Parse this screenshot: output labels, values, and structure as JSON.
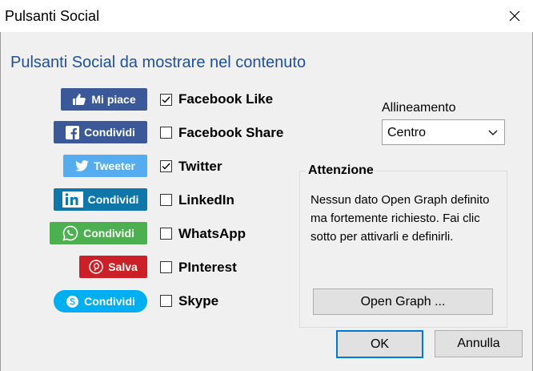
{
  "window": {
    "title": "Pulsanti Social"
  },
  "heading": "Pulsanti Social da mostrare nel contenuto",
  "social": [
    {
      "button_label": "Mi piace",
      "icon": "thumbs-up-icon",
      "color": "#3b5998",
      "checkbox_label": "Facebook Like",
      "checked": true
    },
    {
      "button_label": "Condividi",
      "icon": "facebook-icon",
      "color": "#3b5998",
      "checkbox_label": "Facebook Share",
      "checked": false
    },
    {
      "button_label": "Tweeter",
      "icon": "twitter-bird-icon",
      "color": "#55acee",
      "checkbox_label": "Twitter",
      "checked": true
    },
    {
      "button_label": "Condividi",
      "icon": "linkedin-icon",
      "color": "#0e76a8",
      "checkbox_label": "LinkedIn",
      "checked": false
    },
    {
      "button_label": "Condividi",
      "icon": "whatsapp-icon",
      "color": "#4caf50",
      "checkbox_label": "WhatsApp",
      "checked": false
    },
    {
      "button_label": "Salva",
      "icon": "pinterest-icon",
      "color": "#cb2027",
      "checkbox_label": "PInterest",
      "checked": false
    },
    {
      "button_label": "Condividi",
      "icon": "skype-icon",
      "color": "#00aff0",
      "checkbox_label": "Skype",
      "checked": false
    }
  ],
  "alignment": {
    "label": "Allineamento",
    "value": "Centro"
  },
  "warning": {
    "title": "Attenzione",
    "text": "Nessun dato Open Graph definito ma fortemente richiesto. Fai clic sotto per attivarli e definirli.",
    "button": "Open Graph ..."
  },
  "buttons": {
    "ok": "OK",
    "cancel": "Annulla"
  }
}
